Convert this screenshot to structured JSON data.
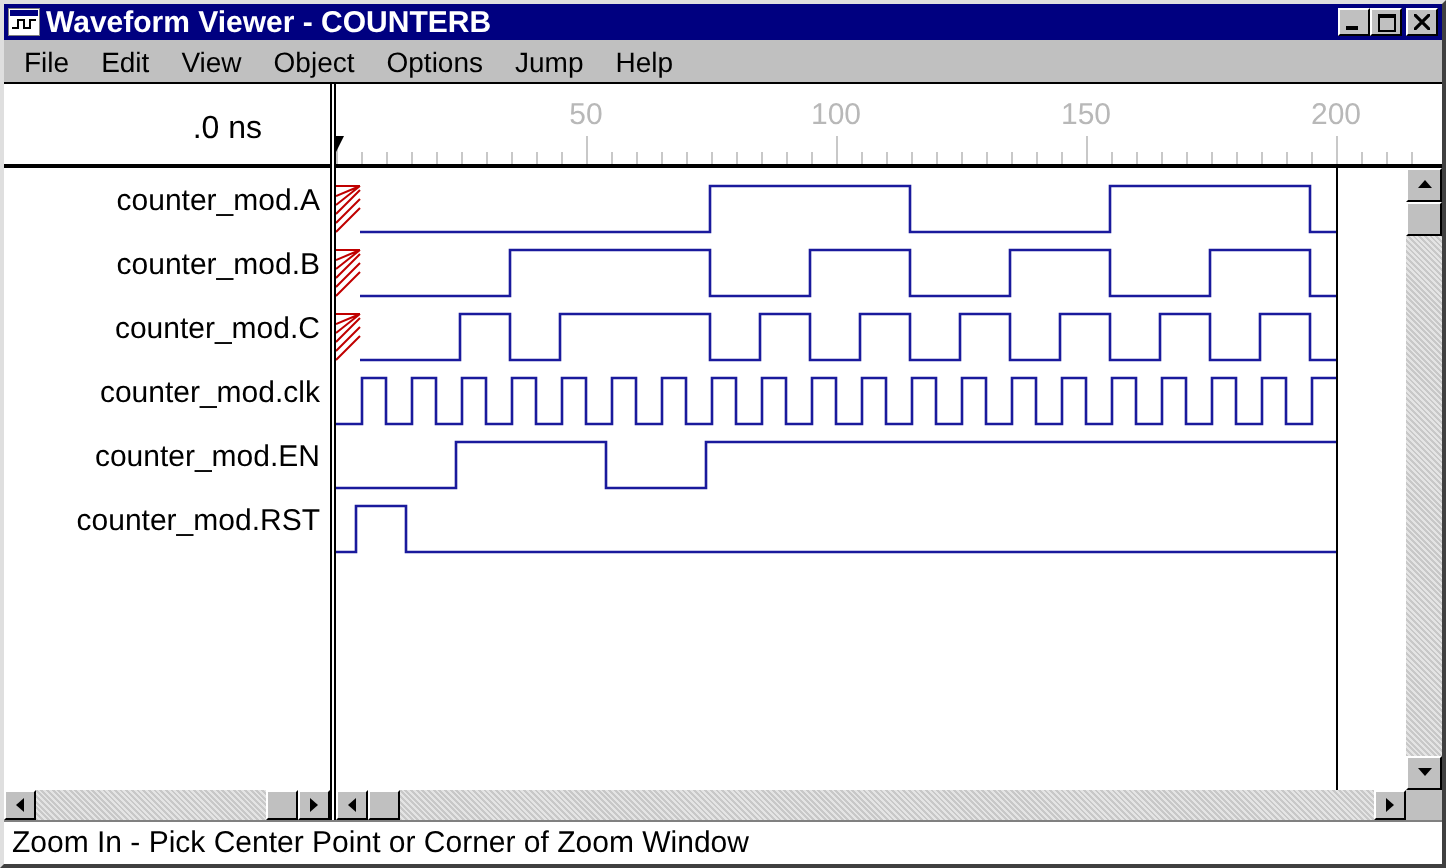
{
  "window": {
    "title": "Waveform Viewer - COUNTERB"
  },
  "menu": [
    "File",
    "Edit",
    "View",
    "Object",
    "Options",
    "Jump",
    "Help"
  ],
  "time_cursor": ".0 ns",
  "ruler_labels": [
    "50",
    "100",
    "150",
    "200"
  ],
  "signals": [
    {
      "name": "counter_mod.A"
    },
    {
      "name": "counter_mod.B"
    },
    {
      "name": "counter_mod.C"
    },
    {
      "name": "counter_mod.clk"
    },
    {
      "name": "counter_mod.EN"
    },
    {
      "name": "counter_mod.RST"
    }
  ],
  "status_bar": "Zoom In - Pick Center Point or Corner of Zoom Window"
}
